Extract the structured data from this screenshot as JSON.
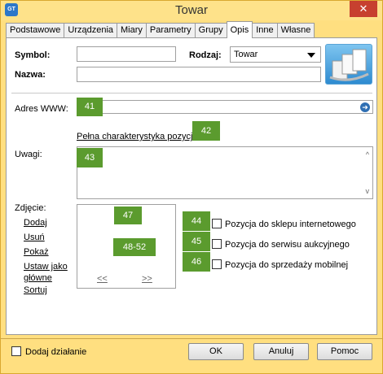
{
  "window": {
    "title": "Towar",
    "app_icon": "GT",
    "close_glyph": "✕"
  },
  "tabs": [
    {
      "label": "Podstawowe"
    },
    {
      "label": "Urządzenia"
    },
    {
      "label": "Miary"
    },
    {
      "label": "Parametry"
    },
    {
      "label": "Grupy"
    },
    {
      "label": "Opis",
      "active": true
    },
    {
      "label": "Inne"
    },
    {
      "label": "Własne"
    }
  ],
  "header": {
    "symbol_label": "Symbol:",
    "symbol_value": "",
    "rodzaj_label": "Rodzaj:",
    "rodzaj_value": "Towar",
    "nazwa_label": "Nazwa:",
    "nazwa_value": ""
  },
  "opis": {
    "www_label": "Adres WWW:",
    "www_marker": "41",
    "pelna_link": "Pełna charakterystyka pozycji",
    "pelna_marker": "42",
    "uwagi_label": "Uwagi:",
    "uwagi_marker": "43",
    "scroll_up": "^",
    "scroll_down": "v"
  },
  "zdjecie": {
    "label": "Zdjęcie:",
    "links": [
      "Dodaj",
      "Usuń",
      "Pokaż",
      "Ustaw jako główne",
      "Sortuj"
    ],
    "marker_top": "47",
    "marker_mid": "48-52",
    "prev": "<<",
    "next": ">>"
  },
  "checkboxes": [
    {
      "marker": "44",
      "label": "Pozycja do sklepu internetowego",
      "checked": false
    },
    {
      "marker": "45",
      "label": "Pozycja do serwisu aukcyjnego",
      "checked": false
    },
    {
      "marker": "46",
      "label": "Pozycja do sprzedaży mobilnej",
      "checked": false
    }
  ],
  "footer": {
    "dodaj_dzialanie": "Dodaj działanie",
    "ok": "OK",
    "anuluj": "Anuluj",
    "pomoc": "Pomoc"
  },
  "colors": {
    "accent_green": "#5b9b2e",
    "window_bg": "#ffdf80",
    "close_red": "#c7402f"
  }
}
